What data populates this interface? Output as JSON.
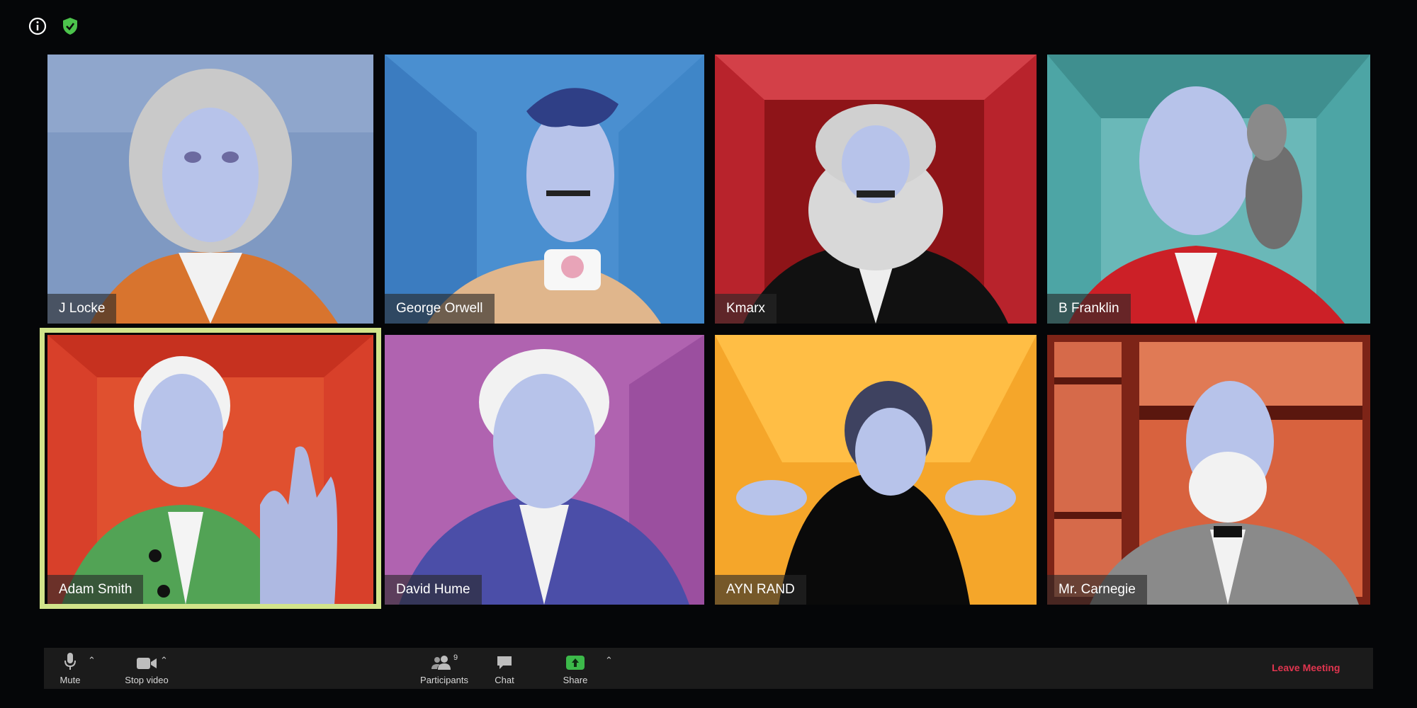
{
  "header": {
    "icons": [
      "info-icon",
      "security-shield-icon"
    ],
    "shield_color": "#4cc34c"
  },
  "participants": [
    {
      "name": "J Locke",
      "bg": "#7f99c2",
      "coat": "#d8742e"
    },
    {
      "name": "George Orwell",
      "bg": "#4a8fd0",
      "coat": "#e0b68c"
    },
    {
      "name": "Kmarx",
      "bg": "#b8232c",
      "coat": "#111111"
    },
    {
      "name": "B Franklin",
      "bg": "#4da5a5",
      "coat": "#cc2027"
    },
    {
      "name": "Adam Smith",
      "bg": "#d8402a",
      "coat": "#52a355"
    },
    {
      "name": "David Hume",
      "bg": "#b063b0",
      "coat": "#4b4ea8"
    },
    {
      "name": "AYN RAND",
      "bg": "#f5a62a",
      "coat": "#0a0a0a"
    },
    {
      "name": "Mr. Carnegie",
      "bg": "#c9432a",
      "coat": "#8a8a8a"
    }
  ],
  "active_speaker": "Adam Smith",
  "active_color": "#d2e48a",
  "toolbar": {
    "mute_label": "Mute",
    "video_label": "Stop video",
    "participants_label": "Participants",
    "participants_count": "9",
    "chat_label": "Chat",
    "share_label": "Share",
    "share_color": "#3cb94a",
    "leave_label": "Leave Meeting",
    "leave_color": "#e0354f"
  }
}
